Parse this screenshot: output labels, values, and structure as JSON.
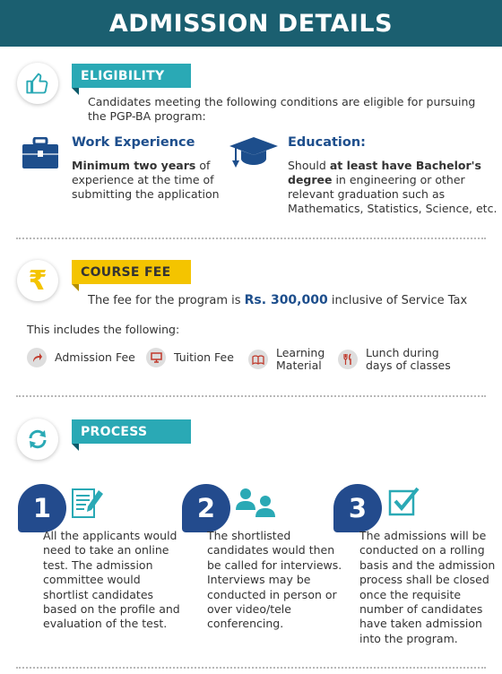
{
  "header": {
    "title": "ADMISSION DETAILS"
  },
  "eligibility": {
    "icon": "thumbs-up-icon",
    "title": "ELIGIBILITY",
    "intro_line1": "Candidates meeting the following conditions are eligible for pursuing",
    "intro_line2": "the PGP-BA program:",
    "work": {
      "icon": "briefcase-icon",
      "heading": "Work Experience",
      "bold": "Minimum two years",
      "line1_rest": " of",
      "line2": "experience at the time of",
      "line3": "submitting the application"
    },
    "education": {
      "icon": "graduation-cap-icon",
      "heading": "Education:",
      "line1_pre": "Should ",
      "line1_bold": "at least have Bachelor's",
      "line2_bold": "degree",
      "line2_rest": " in engineering or other",
      "line3": "relevant graduation such as",
      "line4": "Mathematics, Statistics, Science, etc."
    }
  },
  "course_fee": {
    "icon": "rupee-icon",
    "title": "COURSE FEE",
    "sentence_pre": "The fee for the program is ",
    "amount": "Rs. 300,000",
    "sentence_post": " inclusive of Service Tax",
    "includes_label": "This includes the following:",
    "items": [
      {
        "icon": "arrow-icon",
        "line1": "Admission Fee",
        "line2": ""
      },
      {
        "icon": "monitor-icon",
        "line1": "Tuition Fee",
        "line2": ""
      },
      {
        "icon": "book-icon",
        "line1": "Learning",
        "line2": "Material"
      },
      {
        "icon": "cutlery-icon",
        "line1": "Lunch during",
        "line2": "days of classes"
      }
    ]
  },
  "process": {
    "icon": "refresh-icon",
    "title": "PROCESS",
    "steps": [
      {
        "number": "1",
        "icon": "document-pen-icon",
        "lines": [
          "All the applicants would",
          "need to take an online",
          "test. The admission",
          "committee would",
          "shortlist candidates",
          "based on the profile and",
          "evaluation of the test."
        ]
      },
      {
        "number": "2",
        "icon": "users-icon",
        "lines": [
          "The shortlisted",
          "candidates would then",
          "be called for interviews.",
          "Interviews may be",
          "conducted in person or",
          "over video/tele",
          "conferencing."
        ]
      },
      {
        "number": "3",
        "icon": "checkbox-icon",
        "lines": [
          "The admissions will be",
          "conducted on a rolling",
          "basis and the admission",
          "process shall be closed",
          "once the requisite",
          "number of candidates",
          "have taken admission",
          "into the program."
        ]
      }
    ]
  },
  "colors": {
    "header": "#1b5f70",
    "teal": "#2aa9b5",
    "yellow": "#f4c400",
    "navy": "#234b8d",
    "heading_blue": "#1d4e8c"
  }
}
